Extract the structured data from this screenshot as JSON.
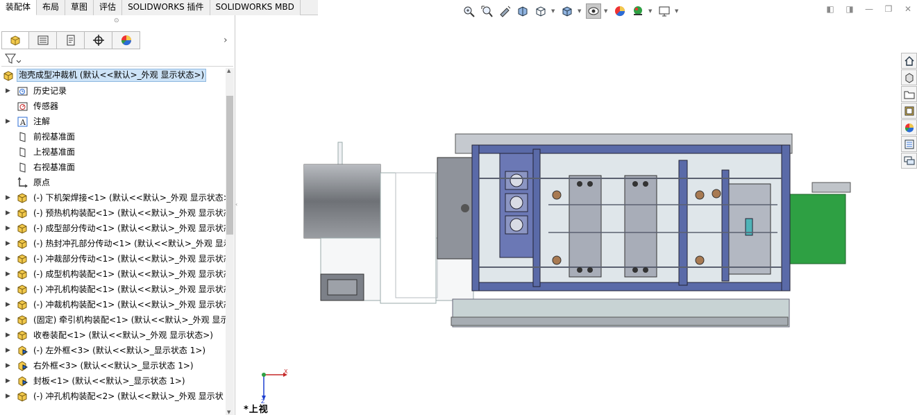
{
  "command_tabs": [
    "装配体",
    "布局",
    "草图",
    "评估",
    "SOLIDWORKS 插件",
    "SOLIDWORKS MBD"
  ],
  "active_tab": "装配体",
  "panel_tabs": [
    "featuremanager-icon",
    "propertymanager-icon",
    "configurationmanager-icon",
    "dimxpert-icon",
    "display-manager-icon"
  ],
  "tree": {
    "root": "泡壳成型冲裁机  (默认<<默认>_外观 显示状态>)",
    "items": [
      {
        "label": "历史记录",
        "icon": "history-icon",
        "expander": true
      },
      {
        "label": "传感器",
        "icon": "sensor-icon",
        "expander": false
      },
      {
        "label": "注解",
        "icon": "annotation-icon",
        "expander": true
      },
      {
        "label": "前视基准面",
        "icon": "plane-icon",
        "expander": false
      },
      {
        "label": "上视基准面",
        "icon": "plane-icon",
        "expander": false
      },
      {
        "label": "右视基准面",
        "icon": "plane-icon",
        "expander": false
      },
      {
        "label": "原点",
        "icon": "origin-icon",
        "expander": false
      },
      {
        "label": "(-) 下机架焊接<1> (默认<<默认>_外观 显示状态>",
        "icon": "assembly-icon",
        "expander": true
      },
      {
        "label": "(-) 预热机构装配<1> (默认<<默认>_外观 显示状态",
        "icon": "assembly-icon",
        "expander": true
      },
      {
        "label": "(-) 成型部分传动<1> (默认<<默认>_外观 显示状态",
        "icon": "assembly-icon",
        "expander": true
      },
      {
        "label": "(-) 热封冲孔部分传动<1> (默认<<默认>_外观 显示",
        "icon": "assembly-icon",
        "expander": true
      },
      {
        "label": "(-) 冲裁部分传动<1> (默认<<默认>_外观 显示状态",
        "icon": "assembly-icon",
        "expander": true
      },
      {
        "label": "(-) 成型机构装配<1> (默认<<默认>_外观 显示状态",
        "icon": "assembly-icon",
        "expander": true
      },
      {
        "label": "(-) 冲孔机构装配<1> (默认<<默认>_外观 显示状态",
        "icon": "assembly-icon",
        "expander": true
      },
      {
        "label": "(-) 冲裁机构装配<1> (默认<<默认>_外观 显示状态",
        "icon": "assembly-icon",
        "expander": true
      },
      {
        "label": "(固定) 牵引机构装配<1> (默认<<默认>_外观 显示状",
        "icon": "assembly-icon",
        "expander": true
      },
      {
        "label": "收卷装配<1> (默认<<默认>_外观 显示状态>)",
        "icon": "assembly-icon",
        "expander": true
      },
      {
        "label": "(-) 左外框<3> (默认<<默认>_显示状态 1>)",
        "icon": "part-icon",
        "expander": true
      },
      {
        "label": "右外框<3> (默认<<默认>_显示状态 1>)",
        "icon": "part-icon",
        "expander": true
      },
      {
        "label": "封板<1> (默认<<默认>_显示状态 1>)",
        "icon": "part-icon",
        "expander": true
      },
      {
        "label": "(-) 冲孔机构装配<2> (默认<<默认>_外观 显示状",
        "icon": "assembly-icon",
        "expander": true
      }
    ]
  },
  "hud_icons": [
    "zoom-to-fit-icon",
    "zoom-to-area-icon",
    "previous-view-icon",
    "section-view-icon",
    "view-orientation-icon",
    "display-style-icon",
    "hide-show-items-icon",
    "edit-appearance-icon",
    "apply-scene-icon",
    "view-settings-icon"
  ],
  "task_pane_icons": [
    "home-icon",
    "design-library-icon",
    "file-explorer-icon",
    "view-palette-icon",
    "appearances-icon",
    "custom-properties-icon",
    "forum-icon"
  ],
  "triad": {
    "x_label": "X",
    "z_label": "Z"
  },
  "view_label": "*上视",
  "colors": {
    "frame_blue": "#5a6aa8",
    "plate_gray": "#a8adb8",
    "conveyor_green": "#2ea043",
    "selection": "#cde3f7"
  }
}
